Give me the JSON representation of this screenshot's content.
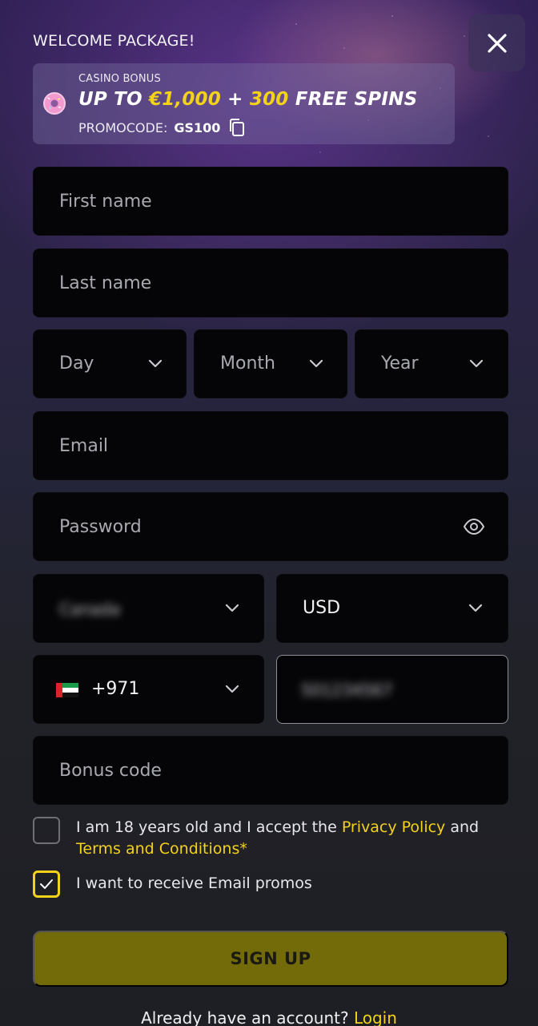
{
  "header": {
    "welcome": "WELCOME PACKAGE!"
  },
  "bonus": {
    "eyebrow": "CASINO BONUS",
    "headline_prefix": "UP TO ",
    "amount": "€1,000",
    "plus": " + ",
    "spins": "300",
    "spins_suffix": " FREE SPINS",
    "promo_label": "PROMOCODE:",
    "promo_code": "GS100"
  },
  "form": {
    "first_name_placeholder": "First name",
    "last_name_placeholder": "Last name",
    "day_label": "Day",
    "month_label": "Month",
    "year_label": "Year",
    "email_placeholder": "Email",
    "password_placeholder": "Password",
    "country_value": "Canada",
    "currency_value": "USD",
    "phone_code": "+971",
    "phone_number": "501234567",
    "bonus_code_placeholder": "Bonus code"
  },
  "consent": {
    "age_text": "I am 18 years old and I accept the ",
    "privacy_link": "Privacy Policy",
    "and_text": " and ",
    "terms_link": "Terms and Conditions",
    "asterisk": "*",
    "age_checked": false,
    "promo_text": "I want to receive Email promos",
    "promo_checked": true
  },
  "actions": {
    "signup_label": "SIGN UP",
    "login_prompt": "Already have an account? ",
    "login_link": "Login"
  },
  "colors": {
    "accent": "#f3d21a",
    "button_bg": "#736a0a",
    "field_bg": "#050507"
  }
}
